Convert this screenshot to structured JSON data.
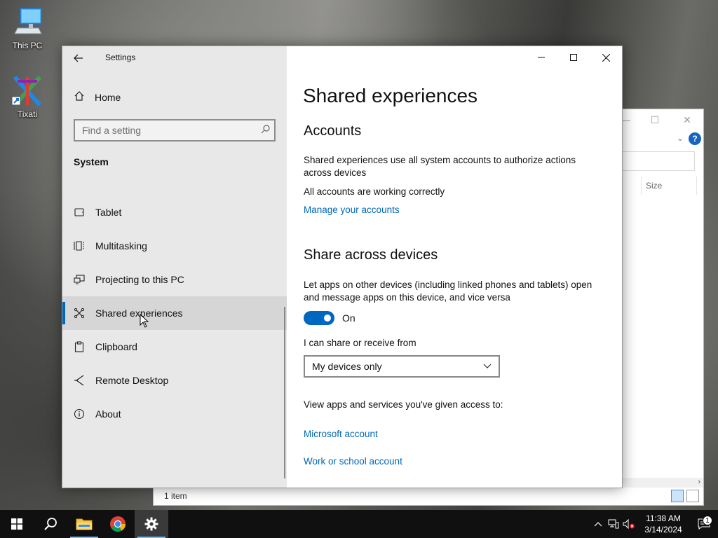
{
  "desktop": {
    "icons": [
      {
        "label": "This PC",
        "icon": "computer-icon"
      },
      {
        "label": "Tixati",
        "icon": "tixati-icon"
      }
    ]
  },
  "explorer": {
    "column_size": "Size",
    "status": "1 item"
  },
  "settings": {
    "window_title": "Settings",
    "home_label": "Home",
    "search_placeholder": "Find a setting",
    "section": "System",
    "nav": [
      {
        "label": "Tablet",
        "icon": "tablet-icon"
      },
      {
        "label": "Multitasking",
        "icon": "multitasking-icon"
      },
      {
        "label": "Projecting to this PC",
        "icon": "projecting-icon"
      },
      {
        "label": "Shared experiences",
        "icon": "shared-experiences-icon",
        "selected": true
      },
      {
        "label": "Clipboard",
        "icon": "clipboard-icon"
      },
      {
        "label": "Remote Desktop",
        "icon": "remote-desktop-icon"
      },
      {
        "label": "About",
        "icon": "info-icon"
      }
    ],
    "page_title": "Shared experiences",
    "accounts": {
      "heading": "Accounts",
      "description": "Shared experiences use all system accounts to authorize actions across devices",
      "status": "All accounts are working correctly",
      "manage_link": "Manage your accounts"
    },
    "share": {
      "heading": "Share across devices",
      "description": "Let apps on other devices (including linked phones and tablets) open and message apps on this device, and vice versa",
      "toggle_state": "On",
      "share_from_label": "I can share or receive from",
      "share_from_value": "My devices only",
      "access_label": "View apps and services you've given access to:",
      "microsoft_link": "Microsoft account",
      "work_link": "Work or school account"
    }
  },
  "taskbar": {
    "time": "11:38 AM",
    "date": "3/14/2024",
    "notification_count": "1",
    "accent": "#76b9ed"
  }
}
